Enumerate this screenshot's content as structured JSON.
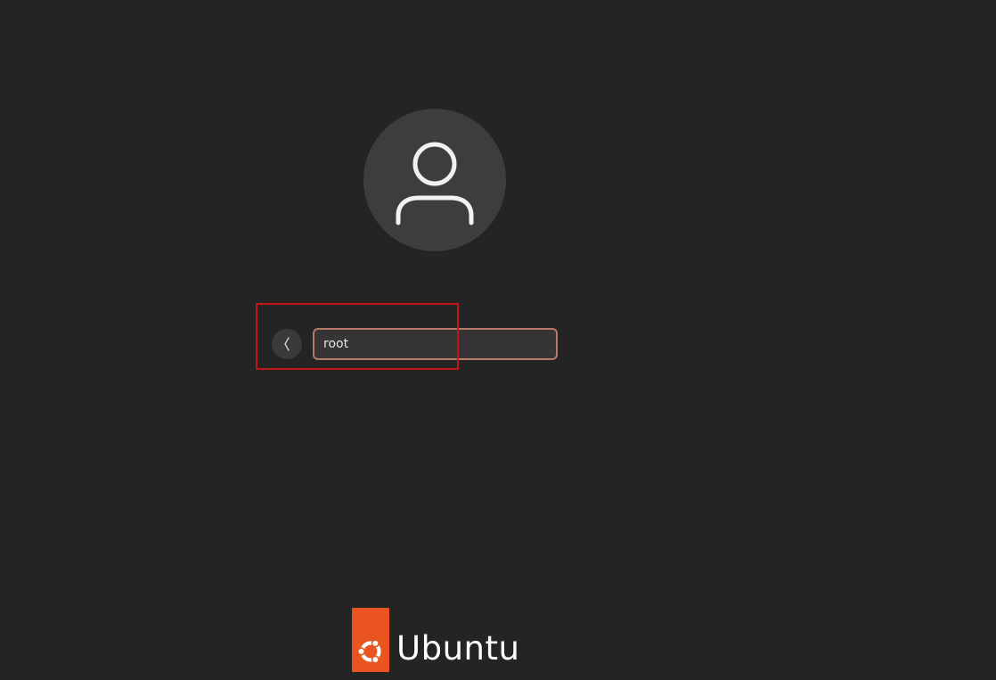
{
  "login": {
    "username_value": "root",
    "avatar_icon": "user-icon",
    "back_icon": "chevron-left-icon"
  },
  "branding": {
    "logo_text": "Ubuntu",
    "logo_icon": "ubuntu-circle-of-friends-icon",
    "brand_color": "#e95420"
  },
  "colors": {
    "background": "#242424",
    "field_border_focus": "#b77a6a",
    "annotation_box": "#c0161a"
  }
}
